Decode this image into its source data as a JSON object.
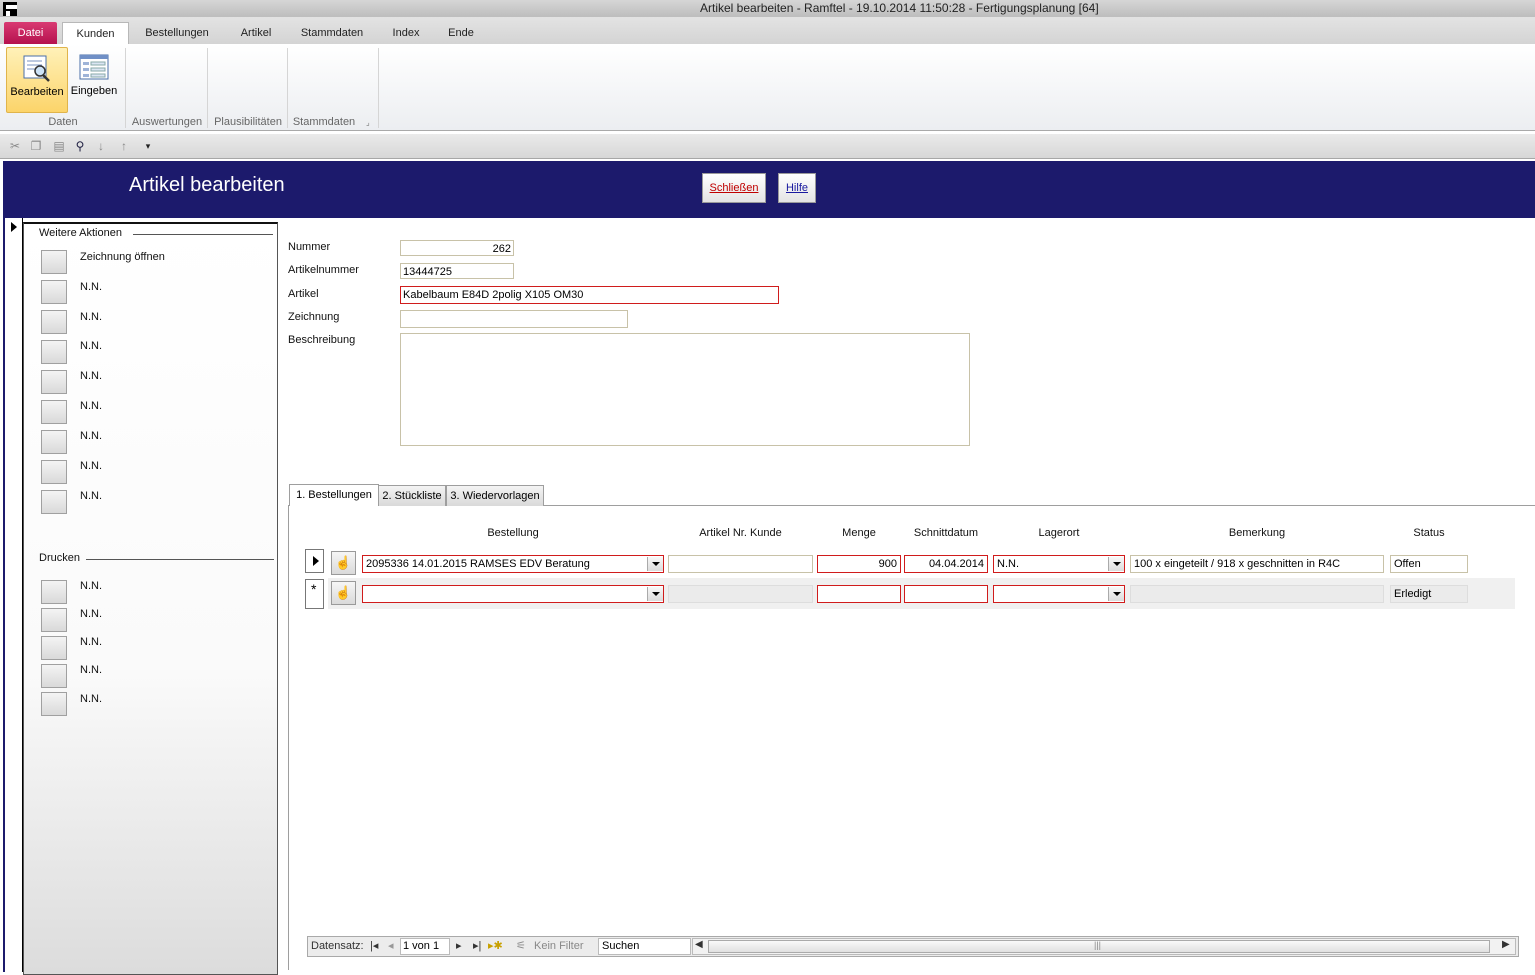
{
  "window": {
    "title": "Artikel bearbeiten - Ramftel - 19.10.2014 11:50:28  -  Fertigungsplanung [64]"
  },
  "ribbon": {
    "tabs": [
      "Datei",
      "Kunden",
      "Bestellungen",
      "Artikel",
      "Stammdaten",
      "Index",
      "Ende"
    ],
    "buttons": {
      "bearbeiten": "Bearbeiten",
      "eingeben": "Eingeben"
    },
    "groups": [
      "Daten",
      "Auswertungen",
      "Plausibilitäten",
      "Stammdaten"
    ]
  },
  "quick_toolbar": {
    "icons": [
      "cut-icon",
      "copy-icon",
      "paste-icon",
      "find-icon",
      "sort-asc-icon",
      "sort-desc-icon",
      "customize-dropdown-icon"
    ]
  },
  "form": {
    "title": "Artikel bearbeiten",
    "close_label": "Schließen",
    "help_label": "Hilfe",
    "fields": {
      "nummer": {
        "label": "Nummer",
        "value": "262"
      },
      "artikelnummer": {
        "label": "Artikelnummer",
        "value": "13444725"
      },
      "artikel": {
        "label": "Artikel",
        "value": "Kabelbaum E84D 2polig X105 OM30"
      },
      "zeichnung": {
        "label": "Zeichnung",
        "value": ""
      },
      "beschreibung": {
        "label": "Beschreibung",
        "value": ""
      }
    }
  },
  "sidepanel": {
    "actions_heading": "Weitere Aktionen",
    "actions": [
      "Zeichnung öffnen",
      "N.N.",
      "N.N.",
      "N.N.",
      "N.N.",
      "N.N.",
      "N.N.",
      "N.N.",
      "N.N."
    ],
    "print_heading": "Drucken",
    "print": [
      "N.N.",
      "N.N.",
      "N.N.",
      "N.N.",
      "N.N."
    ]
  },
  "tabs": [
    "1. Bestellungen",
    "2. Stückliste",
    "3. Wiedervorlagen"
  ],
  "grid": {
    "columns": [
      "Bestellung",
      "Artikel Nr. Kunde",
      "Menge",
      "Schnittdatum",
      "Lagerort",
      "Bemerkung",
      "Status"
    ],
    "rows": [
      {
        "bestellung": "2095336 14.01.2015 RAMSES EDV Beratung",
        "artikel_nr_kunde": "",
        "menge": "900",
        "schnittdatum": "04.04.2014",
        "lagerort": "N.N.",
        "bemerkung": "100 x eingeteilt / 918 x geschnitten in R4C",
        "status": "Offen"
      },
      {
        "bestellung": "",
        "artikel_nr_kunde": "",
        "menge": "",
        "schnittdatum": "",
        "lagerort": "",
        "bemerkung": "",
        "status": "Erledigt"
      }
    ],
    "new_row_marker": "*"
  },
  "navbar": {
    "label": "Datensatz:",
    "position": "1 von 1",
    "filter": "Kein Filter",
    "search": "Suchen"
  }
}
